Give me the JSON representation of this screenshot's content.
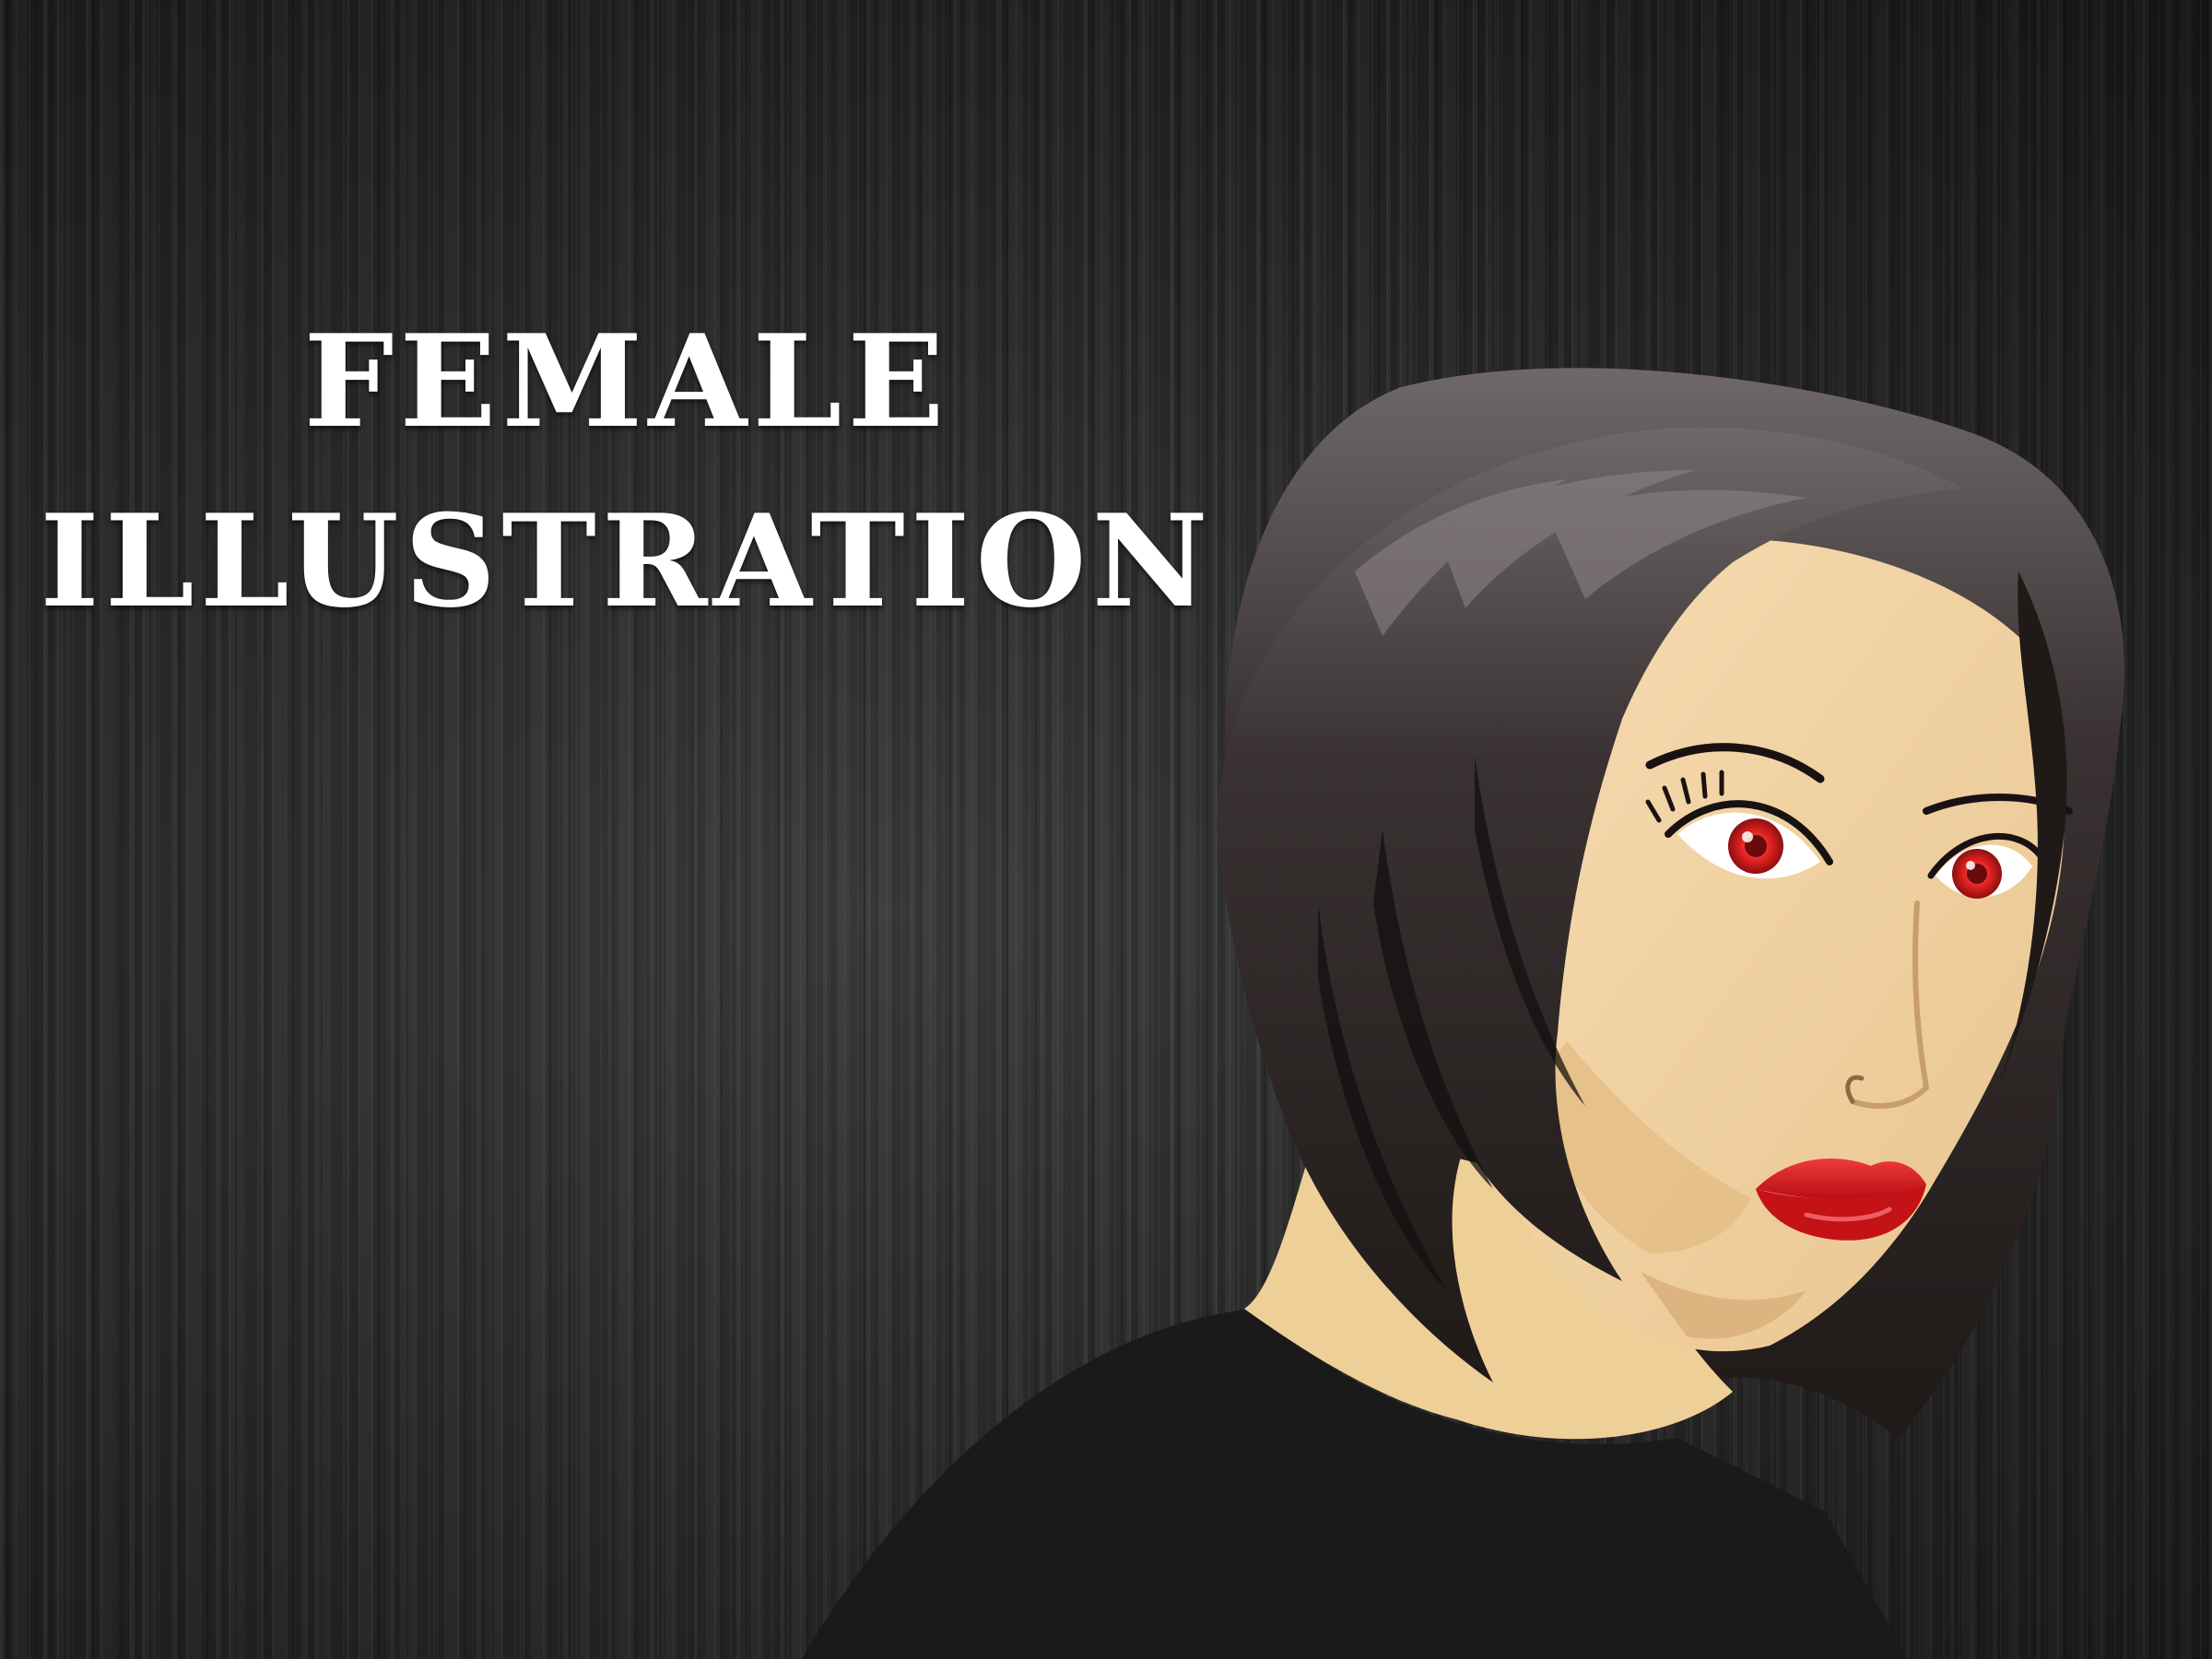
{
  "title": {
    "line1": "FEMALE",
    "line2": "ILLUSTRATION"
  },
  "illustration": {
    "subject": "woman-portrait",
    "colors": {
      "background": "#2a2a2a",
      "hair": "#2b2322",
      "skin": "#f3d7a8",
      "shirt": "#1b1a1a",
      "iris": "#e0201f",
      "lips": "#d8181c"
    }
  }
}
